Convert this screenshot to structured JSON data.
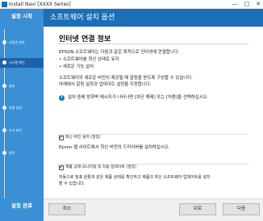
{
  "window": {
    "title": "Install Navi [XXXX Series]",
    "minimize_glyph": "—",
    "maximize_glyph": "□",
    "close_glyph": "✕"
  },
  "sidebar": {
    "heading": "설정 시작",
    "footer": "설정 완료",
    "steps": [
      {
        "label": "사용권 계약",
        "active": false
      },
      {
        "label": "시스템 확인",
        "active": true
      },
      {
        "label": "설치",
        "active": false
      },
      {
        "label": "연결 설정",
        "active": false
      },
      {
        "label": "추가 설치",
        "active": false
      },
      {
        "label": "완료",
        "active": false
      }
    ]
  },
  "header": {
    "title": "소프트웨어 설치 옵션"
  },
  "main": {
    "title": "인터넷 연결 정보",
    "paragraph1": "EPSON 소프트웨어는 다음과 같은 목적으로 인터넷에 연결합니다.",
    "bullets": [
      "• 소프트웨어를 최신 상태로 유지",
      "• 새로운 기능 설치"
    ],
    "paragraph2_line1": "소프트웨어의 새로운 버전이 제공될 때 알림을 받도록 구성할 수 있습니다.",
    "paragraph2_line2": "아래에서 알림 설정과 업데이트 설정을 지정합니다.",
    "info_icon": "info-icon",
    "info_text": "설치 중에 방화벽 메시지가 나타나면 [차단 해제] 또는 [허용]을 선택하십시오.",
    "option1": {
      "checked": true,
      "label": "최신 버전 설치 (권장)",
      "desc": "Epson 웹 사이트에서 최신 버전의 드라이버를 설치하십시오."
    },
    "option2": {
      "checked": true,
      "label": "제품 상태 모니터링 및 자동 업데이트 (권장)",
      "desc_line1": "자동으로 정표 원활과 같은 제품 상태를 확인하고 제품의 최신 소프트웨어 업데이트를 설치",
      "desc_line2": "할 수 있습니다."
    }
  },
  "footer": {
    "cancel_label": "취소",
    "back_label": "뒤로",
    "next_label": "다음"
  },
  "colors": {
    "sidebar": "#3b8fd4",
    "header": "#1a6fb8",
    "active_step": "#1d62a8"
  }
}
